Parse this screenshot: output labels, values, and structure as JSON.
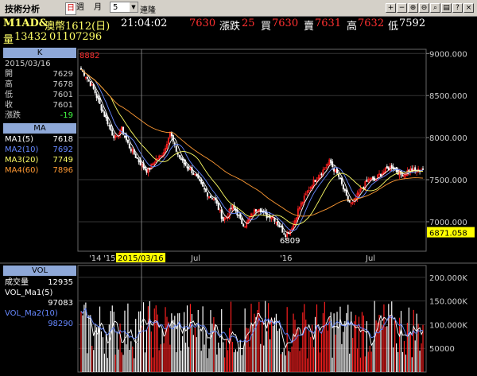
{
  "toolbar": {
    "app_title": "技術分析",
    "period_day": "日",
    "period_week": "週",
    "period_month": "月",
    "period_count": "5",
    "link_label": "連隆"
  },
  "header": {
    "symbol": "M1AD&",
    "contract": "澳幣1612(日)",
    "time": "21:04:02",
    "last": "7630",
    "change_label": "漲跌",
    "change": "25",
    "bid_label": "買",
    "bid": "7630",
    "ask_label": "賣",
    "ask": "7631",
    "high_label": "高",
    "high": "7632",
    "low_label": "低",
    "low": "7592",
    "volume_label": "量",
    "volume": "13432",
    "open_interest": "01107296"
  },
  "k_panel": {
    "title": "K",
    "date": "2015/03/16",
    "rows": [
      {
        "label": "開",
        "value": "7629"
      },
      {
        "label": "高",
        "value": "7678"
      },
      {
        "label": "低",
        "value": "7601"
      },
      {
        "label": "收",
        "value": "7601"
      },
      {
        "label": "漲跌",
        "value": "-19"
      }
    ]
  },
  "ma_panel": {
    "title": "MA",
    "rows": [
      {
        "label": "MA1(5)",
        "value": "7618",
        "color": "#ffffff"
      },
      {
        "label": "MA2(10)",
        "value": "7692",
        "color": "#6688ff"
      },
      {
        "label": "MA3(20)",
        "value": "7749",
        "color": "#ffff66"
      },
      {
        "label": "MA4(60)",
        "value": "7896",
        "color": "#ff9933"
      }
    ]
  },
  "vol_panel": {
    "title": "VOL",
    "rows": [
      {
        "label": "成交量",
        "value": "12935",
        "color": "#ffffff"
      },
      {
        "label": "VOL_Ma1(5)",
        "value": "97083",
        "color": "#ffffff"
      },
      {
        "label": "VOL_Ma2(10)",
        "value": "98290",
        "color": "#6688ff"
      }
    ]
  },
  "chart_data": {
    "type": "candlestick",
    "price_axis": {
      "ticks": [
        "9000.000",
        "8500.000",
        "8000.000",
        "7500.000",
        "7000.000"
      ],
      "ylim": [
        6650,
        9050
      ]
    },
    "current_price_label": "6871.058",
    "annotations": {
      "high_marker": "8882",
      "low_marker": "6809"
    },
    "volume_axis": {
      "ticks": [
        "200.000K",
        "150.000K",
        "100.000K",
        "50000"
      ],
      "ylim": [
        0,
        225000
      ]
    },
    "x_ticks": [
      "'14",
      "'15",
      "2015/03/16",
      "Jul",
      "'16",
      "Jul"
    ],
    "selected_date": "2015/03/16",
    "close_path": [
      8810,
      8740,
      8650,
      8560,
      8420,
      8300,
      8180,
      8050,
      7980,
      8120,
      7990,
      7880,
      7800,
      7720,
      7650,
      7600,
      7680,
      7750,
      7780,
      7880,
      8080,
      7900,
      7780,
      7700,
      7650,
      7600,
      7520,
      7440,
      7360,
      7300,
      7280,
      7150,
      7020,
      7080,
      7180,
      7120,
      7000,
      6960,
      7050,
      7120,
      7180,
      7100,
      7060,
      7080,
      7000,
      6920,
      6850,
      6900,
      6990,
      7160,
      7250,
      7360,
      7450,
      7520,
      7580,
      7640,
      7720,
      7620,
      7540,
      7400,
      7260,
      7200,
      7290,
      7380,
      7450,
      7520,
      7480,
      7550,
      7590,
      7630,
      7660,
      7610,
      7560,
      7580,
      7620,
      7600,
      7610,
      7630
    ],
    "volume_baseline": 95000
  },
  "colors": {
    "up": "#ff2020",
    "down": "#ffffff",
    "grid": "#333333",
    "axis_text": "#cccccc",
    "highlight_date_bg": "#ffff00",
    "price_label_bg": "#ffff00"
  }
}
